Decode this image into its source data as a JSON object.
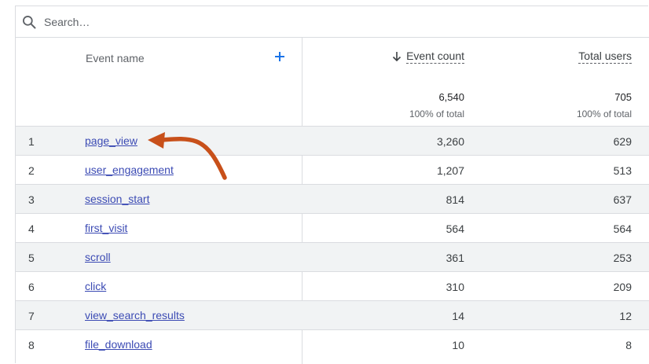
{
  "search": {
    "placeholder": "Search…"
  },
  "header": {
    "event_name": "Event name",
    "event_count": "Event count",
    "total_users": "Total users",
    "add_icon": "plus-icon",
    "sort_icon": "arrow-down-icon"
  },
  "totals": {
    "event_count": "6,540",
    "event_count_pct": "100% of total",
    "total_users": "705",
    "total_users_pct": "100% of total"
  },
  "rows": [
    {
      "idx": "1",
      "name": "page_view",
      "event_count": "3,260",
      "total_users": "629"
    },
    {
      "idx": "2",
      "name": "user_engagement",
      "event_count": "1,207",
      "total_users": "513"
    },
    {
      "idx": "3",
      "name": "session_start",
      "event_count": "814",
      "total_users": "637"
    },
    {
      "idx": "4",
      "name": "first_visit",
      "event_count": "564",
      "total_users": "564"
    },
    {
      "idx": "5",
      "name": "scroll",
      "event_count": "361",
      "total_users": "253"
    },
    {
      "idx": "6",
      "name": "click",
      "event_count": "310",
      "total_users": "209"
    },
    {
      "idx": "7",
      "name": "view_search_results",
      "event_count": "14",
      "total_users": "12"
    },
    {
      "idx": "8",
      "name": "file_download",
      "event_count": "10",
      "total_users": "8"
    }
  ],
  "colors": {
    "annotation_arrow": "#c8501a",
    "link": "#3c4bb4",
    "accent": "#1a73e8"
  }
}
